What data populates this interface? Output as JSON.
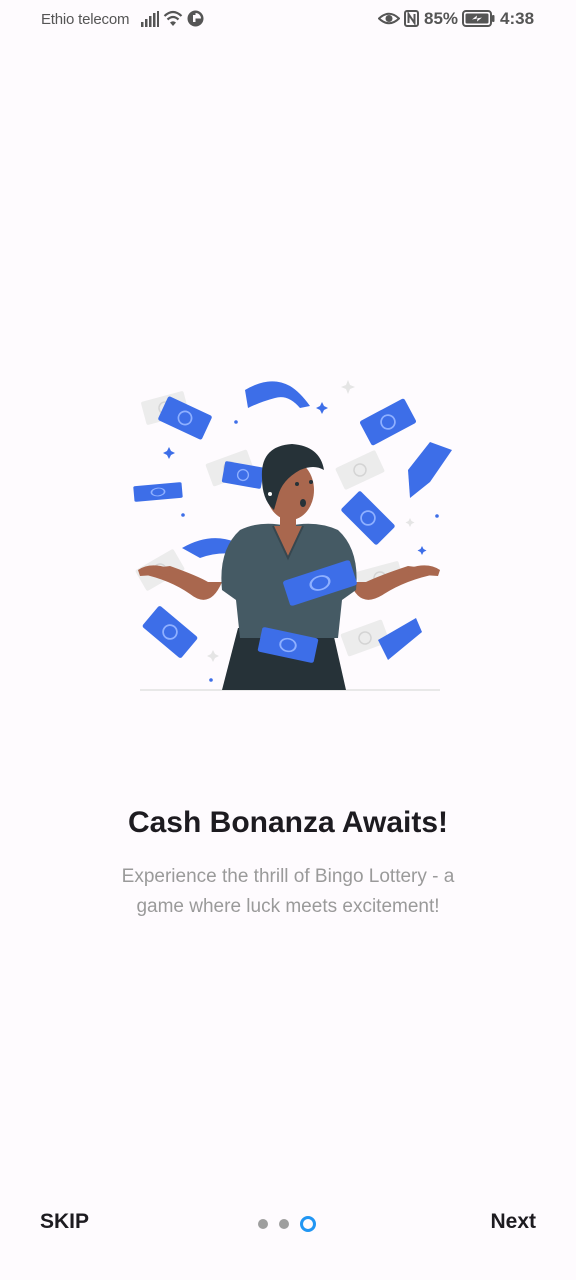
{
  "status_bar": {
    "carrier": "Ethio telecom",
    "battery_percent": "85%",
    "time": "4:38",
    "icons": [
      "signal-icon",
      "wifi-icon",
      "data-saver-icon",
      "eye-comfort-icon",
      "nfc-icon",
      "battery-charging-icon"
    ]
  },
  "onboarding": {
    "illustration": "woman-money-rain-illustration",
    "title": "Cash Bonanza Awaits!",
    "subtitle": "Experience the thrill of Bingo Lottery - a game where luck meets excitement!",
    "page_count": 3,
    "current_page": 3
  },
  "navigation": {
    "skip_label": "SKIP",
    "next_label": "Next"
  },
  "colors": {
    "background": "#fefbfe",
    "accent": "#2196f3",
    "money_blue": "#3d6ee8",
    "text_primary": "#1d1b20",
    "text_secondary": "#9a9a9a"
  }
}
